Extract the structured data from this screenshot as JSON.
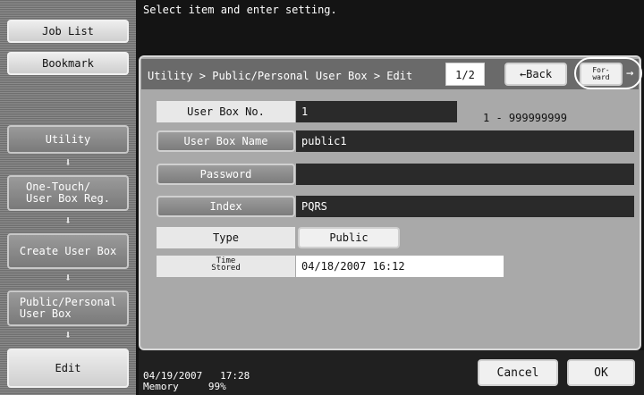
{
  "header": {
    "instruction": "Select item and enter setting."
  },
  "left_nav": {
    "job_list": "Job List",
    "bookmark": "Bookmark",
    "steps": [
      "Utility",
      "One-Touch/\nUser Box Reg.",
      "Create User Box",
      "Public/Personal\nUser Box",
      "Edit"
    ]
  },
  "title_bar": {
    "breadcrumb": "Utility > Public/Personal User  Box > Edit",
    "page": "1/2",
    "back": "←Back",
    "forward": "For-\nward",
    "forward_arrow": "→"
  },
  "form": {
    "user_box_no_label": "User Box No.",
    "user_box_no_value": "1",
    "user_box_no_range": "1 - 999999999",
    "user_box_name_label": "User Box Name",
    "user_box_name_value": "public1",
    "password_label": "Password",
    "password_value": "",
    "index_label": "Index",
    "index_value": "PQRS",
    "type_label": "Type",
    "type_value": "Public",
    "time_stored_label_1": "Time",
    "time_stored_label_2": "Stored",
    "time_stored_value": "04/18/2007  16:12"
  },
  "footer": {
    "date": "04/19/2007",
    "time": "17:28",
    "memory_label": "Memory",
    "memory_value": "99%",
    "cancel": "Cancel",
    "ok": "OK"
  }
}
